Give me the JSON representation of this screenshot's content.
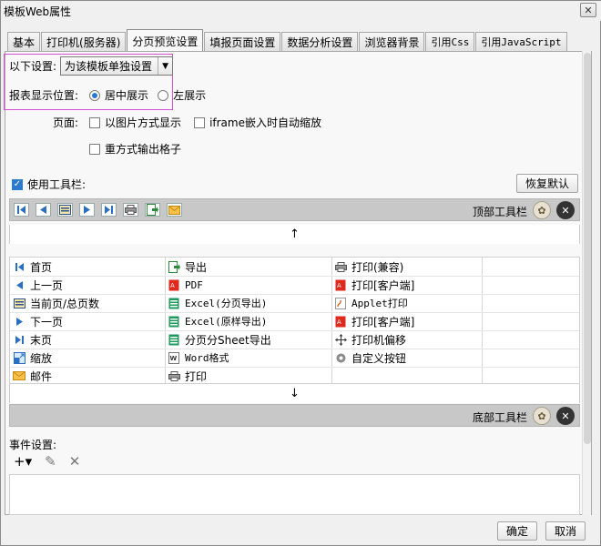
{
  "window": {
    "title": "模板Web属性",
    "close": "✕"
  },
  "tabs": [
    "基本",
    "打印机(服务器)",
    "分页预览设置",
    "填报页面设置",
    "数据分析设置",
    "浏览器背景",
    "引用Css",
    "引用JavaScript"
  ],
  "settings": {
    "label": "以下设置:",
    "selected": "为该模板单独设置"
  },
  "position": {
    "label": "报表显示位置:",
    "center": "居中展示",
    "left": "左展示"
  },
  "page": {
    "label": "页面:",
    "image_mode": "以图片方式显示",
    "iframe_zoom": "iframe嵌入时自动缩放",
    "repeat_cells": "重方式输出格子"
  },
  "toolbar": {
    "use_label": "使用工具栏:",
    "restore": "恢复默认",
    "top_label": "顶部工具栏",
    "bottom_label": "底部工具栏",
    "up_arrow": "↑",
    "down_arrow": "↓"
  },
  "items": {
    "col1": [
      "首页",
      "上一页",
      "当前页/总页数",
      "下一页",
      "末页",
      "缩放",
      "邮件"
    ],
    "col2": [
      "导出",
      "PDF",
      "Excel(分页导出)",
      "Excel(原样导出)",
      "分页分Sheet导出",
      "Word格式",
      "打印"
    ],
    "col3": [
      "打印(兼容)",
      "打印[客户端]",
      "Applet打印",
      "打印[客户端]",
      "打印机偏移",
      "自定义按钮"
    ]
  },
  "events": {
    "label": "事件设置:",
    "add": "+▾",
    "edit": "✎",
    "delete": "✕"
  },
  "footer": {
    "ok": "确定",
    "cancel": "取消"
  },
  "colors": {
    "accent": "#2a7ad0",
    "highlight": "#d64fd6",
    "strip": "#c8c8c8"
  }
}
